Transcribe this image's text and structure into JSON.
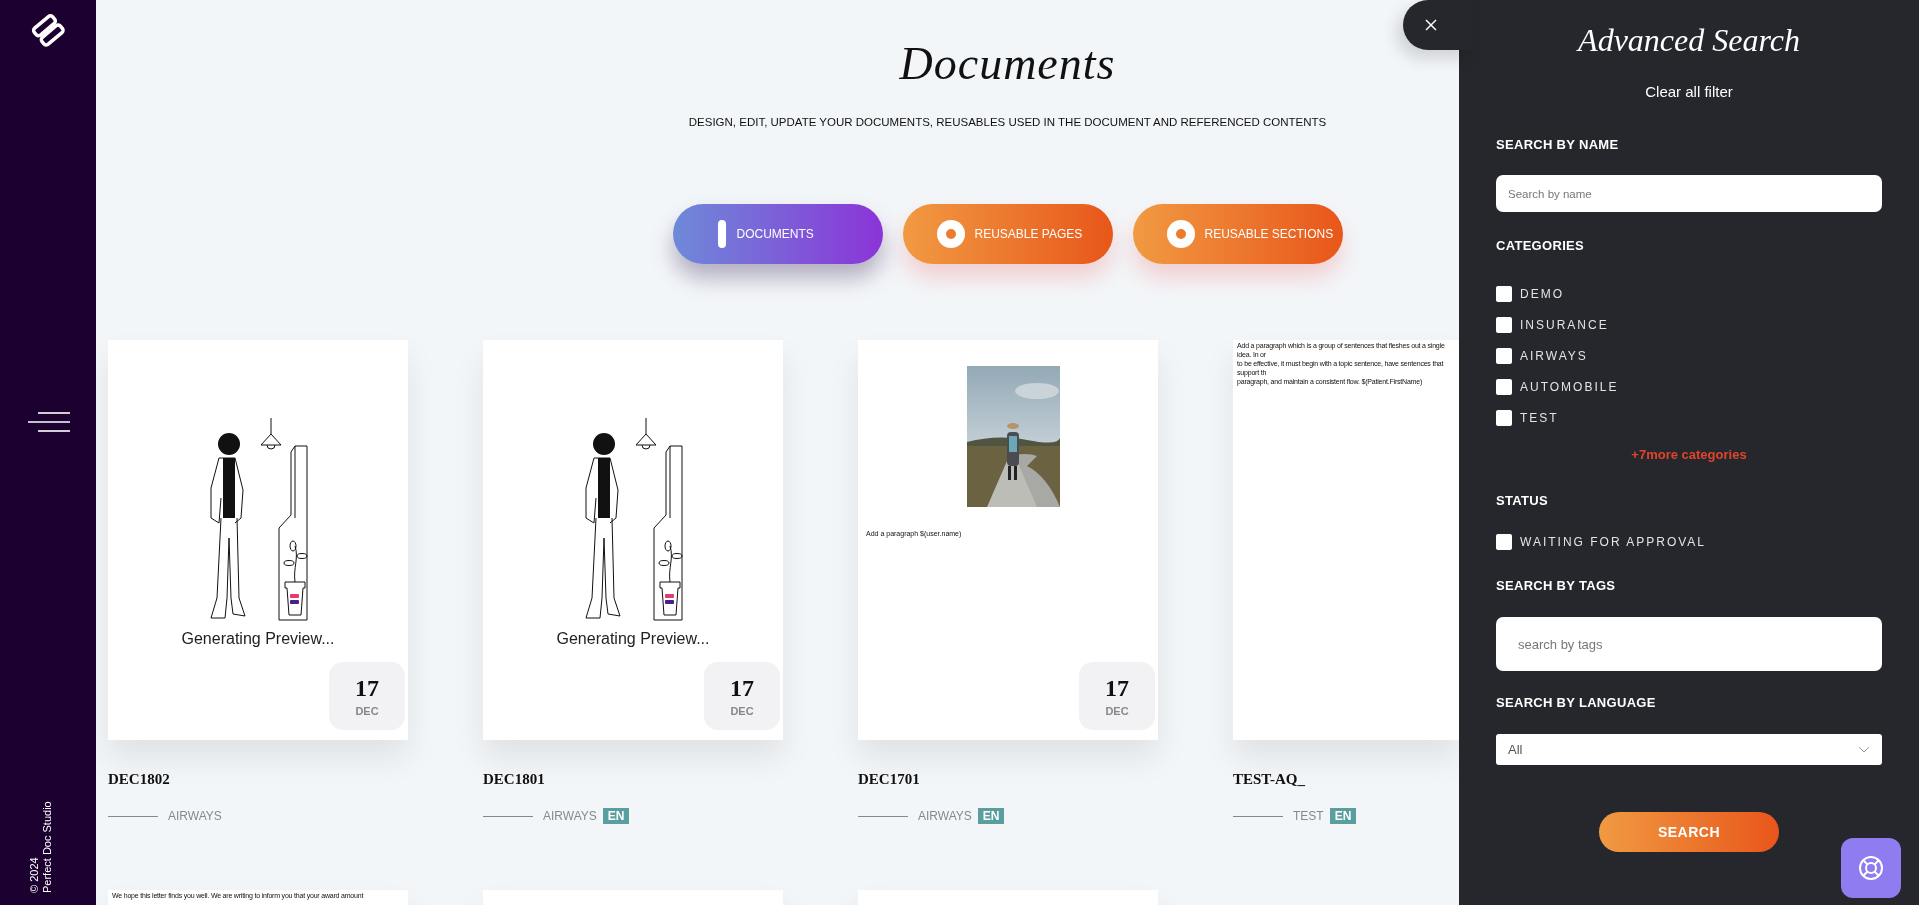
{
  "sidebar": {
    "copyright": "© 2024",
    "brand": "Perfect Doc Studio"
  },
  "header": {
    "title": "Documents",
    "subtitle": "DESIGN, EDIT, UPDATE YOUR DOCUMENTS, REUSABLES USED IN THE DOCUMENT AND REFERENCED CONTENTS"
  },
  "type_tabs": [
    {
      "label": "DOCUMENTS",
      "selected": true
    },
    {
      "label": "REUSABLE PAGES",
      "selected": false
    },
    {
      "label": "REUSABLE SECTIONS",
      "selected": false
    }
  ],
  "documents": [
    {
      "name": "DEC1802",
      "category": "AIRWAYS",
      "preview": {
        "kind": "generating",
        "text": "Generating Preview..."
      },
      "date": {
        "day": "17",
        "month": "DEC"
      }
    },
    {
      "name": "DEC1801",
      "category": "AIRWAYS",
      "language": "EN",
      "preview": {
        "kind": "generating",
        "text": "Generating Preview..."
      },
      "date": {
        "day": "17",
        "month": "DEC"
      }
    },
    {
      "name": "DEC1701",
      "category": "AIRWAYS",
      "language": "EN",
      "preview": {
        "caption": "Add a paragraph  $(user.name)"
      },
      "date": {
        "day": "17",
        "month": "DEC"
      }
    },
    {
      "name": "TEST-AQ_",
      "category": "TEST",
      "language": "EN",
      "preview": {
        "kind": "text",
        "lines": [
          "Add a paragraph which is a group of sentences that fleshes out a single idea. In or",
          "to be effective, it must begin with a topic sentence, have sentences that support th",
          "paragraph, and maintain a consistent flow. $(Patient.FirstName)"
        ]
      }
    },
    {
      "preview": {
        "kind": "text",
        "lines": [
          "We hope this letter finds you well. We are writing to inform you that your award amount"
        ]
      }
    },
    {
      "preview": {
        "kind": "text"
      }
    },
    {
      "preview": {
        "kind": "text"
      }
    }
  ],
  "advanced_search": {
    "title": "Advanced Search",
    "clear_filter": "Clear all filter",
    "name_label": "SEARCH BY NAME",
    "name_placeholder": "Search by name",
    "categories_label": "CATEGORIES",
    "categories": [
      {
        "label": "DEMO",
        "checked": false
      },
      {
        "label": "INSURANCE",
        "checked": false
      },
      {
        "label": "AIRWAYS",
        "checked": false
      },
      {
        "label": "AUTOMOBILE",
        "checked": false
      },
      {
        "label": "TEST",
        "checked": false
      }
    ],
    "more_categories": "+7more categories",
    "status_label": "STATUS",
    "statuses": [
      {
        "label": "WAITING FOR APPROVAL",
        "checked": false
      }
    ],
    "tags_label": "SEARCH BY TAGS",
    "tags_placeholder": "search by tags",
    "language_label": "SEARCH BY LANGUAGE",
    "language_value": "All",
    "search_button": "SEARCH"
  }
}
